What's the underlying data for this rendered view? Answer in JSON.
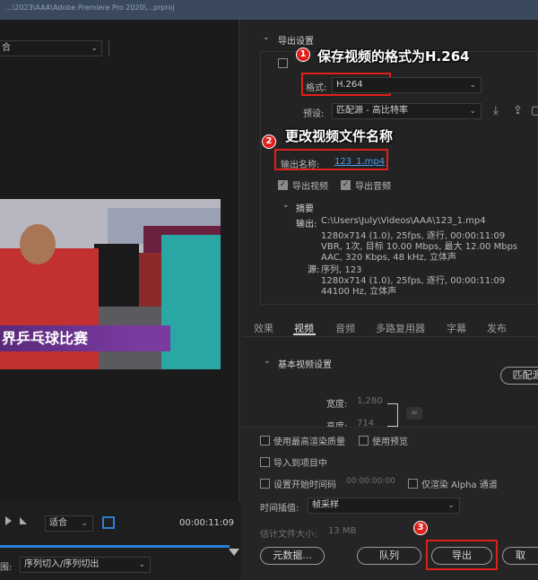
{
  "window": {
    "title_fragment": "...\\2023\\AAA\\Adobe Premiere Pro 2020\\...prproj"
  },
  "left": {
    "source_select": "合",
    "caption": "界乒乓球比赛",
    "fit_select": "适合",
    "timecode": "00:00:11:09",
    "range_label": "围:",
    "range_select": "序列切入/序列切出"
  },
  "export_settings": {
    "section_title": "导出设置",
    "format_label": "格式:",
    "format_value": "H.264",
    "preset_label": "预设:",
    "preset_value": "匹配源 - 高比特率",
    "output_name_label": "输出名称:",
    "output_name_value": "123_1.mp4",
    "export_video_label": "导出视频",
    "export_audio_label": "导出音频"
  },
  "summary": {
    "title": "摘要",
    "output_label": "输出:",
    "output_lines": [
      "C:\\Users\\July\\Videos\\AAA\\123_1.mp4",
      "1280x714 (1.0), 25fps, 逐行, 00:00:11:09",
      "VBR, 1次, 目标 10.00 Mbps, 最大 12.00 Mbps",
      "AAC, 320 Kbps, 48 kHz, 立体声"
    ],
    "source_label": "源:",
    "source_lines": [
      "序列, 123",
      "1280x714 (1.0), 25fps, 逐行, 00:00:11:09",
      "44100 Hz, 立体声"
    ]
  },
  "tabs": [
    "效果",
    "视频",
    "音频",
    "多路复用器",
    "字幕",
    "发布"
  ],
  "active_tab": "视频",
  "video_settings": {
    "title": "基本视频设置",
    "match_source_btn": "匹配源",
    "width_label": "宽度:",
    "width_value": "1,280",
    "height_label": "高度:",
    "height_value": "714"
  },
  "options": {
    "max_render_quality": "使用最高渲染质量",
    "use_previews": "使用预览",
    "import_into_project": "导入到项目中",
    "set_start_timecode": "设置开始时间码",
    "start_timecode_value": "00:00:00:00",
    "render_alpha_only": "仅渲染 Alpha 通道",
    "interpolation_label": "时间插值:",
    "interpolation_value": "帧采样",
    "file_size_label": "估计文件大小:",
    "file_size_value": "13 MB"
  },
  "buttons": {
    "metadata": "元数据...",
    "queue": "队列",
    "export": "导出",
    "cancel": "取"
  },
  "annotations": {
    "a1_number": "1",
    "a1_text": "保存视频的格式为H.264",
    "a2_number": "2",
    "a2_text": "更改视频文件名称",
    "a3_number": "3"
  },
  "colors": {
    "accent_blue": "#2d7fd6",
    "annotation_red": "#e0201b",
    "link_blue": "#4a9ae8"
  }
}
